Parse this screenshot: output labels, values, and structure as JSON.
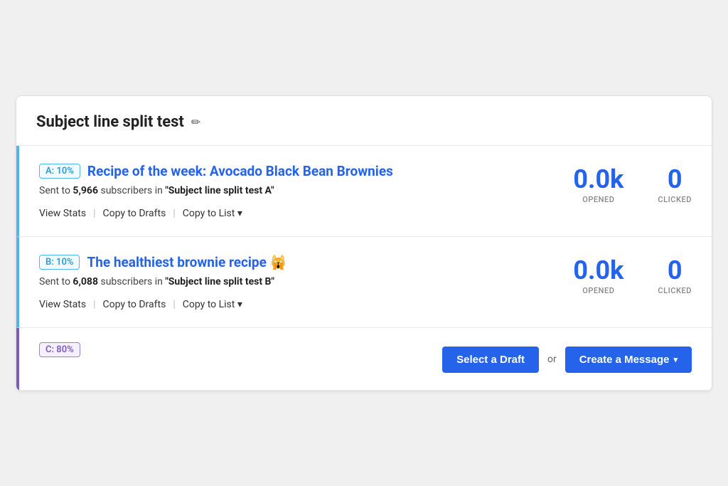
{
  "card": {
    "title": "Subject line split test",
    "edit_icon": "✏"
  },
  "variants": [
    {
      "id": "a",
      "badge": "A: 10%",
      "badge_type": "ab",
      "subject": "Recipe of the week: Avocado Black Bean Brownies",
      "sent_text": "Sent to",
      "sent_count": "5,966",
      "sent_suffix": "subscribers in",
      "list_name": "\"Subject line split test A\"",
      "stats": [
        {
          "value": "0.0k",
          "label": "OPENED"
        },
        {
          "value": "0",
          "label": "CLICKED"
        }
      ],
      "actions": [
        {
          "label": "View Stats",
          "name": "view-stats-a"
        },
        {
          "label": "Copy to Drafts",
          "name": "copy-to-drafts-a"
        },
        {
          "label": "Copy to List",
          "name": "copy-to-list-a",
          "has_arrow": true
        }
      ]
    },
    {
      "id": "b",
      "badge": "B: 10%",
      "badge_type": "ab",
      "subject": "The healthiest brownie recipe 🙀",
      "sent_text": "Sent to",
      "sent_count": "6,088",
      "sent_suffix": "subscribers in",
      "list_name": "\"Subject line split test B\"",
      "stats": [
        {
          "value": "0.0k",
          "label": "OPENED"
        },
        {
          "value": "0",
          "label": "CLICKED"
        }
      ],
      "actions": [
        {
          "label": "View Stats",
          "name": "view-stats-b"
        },
        {
          "label": "Copy to Drafts",
          "name": "copy-to-drafts-b"
        },
        {
          "label": "Copy to List",
          "name": "copy-to-list-b",
          "has_arrow": true
        }
      ]
    }
  ],
  "variant_c": {
    "badge": "C: 80%",
    "badge_type": "c"
  },
  "footer": {
    "select_draft_label": "Select a Draft",
    "or_text": "or",
    "create_message_label": "Create a Message",
    "dropdown_arrow": "▾"
  }
}
